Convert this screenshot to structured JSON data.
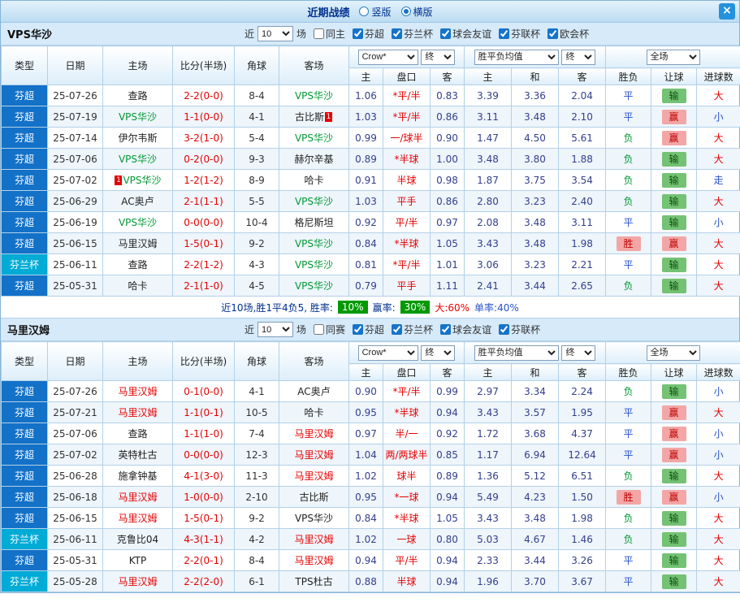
{
  "topbar": {
    "title": "近期战绩",
    "radios": [
      {
        "label": "竖版",
        "selected": false
      },
      {
        "label": "横版",
        "selected": true
      }
    ],
    "close_label": "×"
  },
  "labels": {
    "recent": "近",
    "matches": "场"
  },
  "header": {
    "col_type": "类型",
    "col_date": "日期",
    "col_home": "主场",
    "col_score": "比分(半场)",
    "col_corner": "角球",
    "col_away": "客场",
    "odds_source": "Crow*",
    "odds_final": "终",
    "avg_label": "胜平负均值",
    "avg_final": "终",
    "fulltime": "全场",
    "sub": {
      "home": "主",
      "handicap": "盘口",
      "away": "客",
      "h": "主",
      "d": "和",
      "a": "客",
      "result": "胜负",
      "ah": "让球",
      "goals": "进球数"
    }
  },
  "sections": [
    {
      "team": "VPS华沙",
      "count": "10",
      "same_label": "同主",
      "same_checked": false,
      "leagues": [
        {
          "label": "芬超",
          "checked": true
        },
        {
          "label": "芬兰杯",
          "checked": true
        },
        {
          "label": "球会友谊",
          "checked": true
        },
        {
          "label": "芬联杯",
          "checked": true
        },
        {
          "label": "欧会杯",
          "checked": true
        }
      ],
      "rows": [
        {
          "league": "芬超",
          "date": "25-07-26",
          "home": "查路",
          "score": "2-2(0-0)",
          "corner": "8-4",
          "away": "VPS华沙",
          "away_c": "g",
          "o1": "1.06",
          "hcap": "*平/半",
          "o2": "0.83",
          "w1": "3.39",
          "d": "3.36",
          "w2": "2.04",
          "res": "平",
          "ah": "输",
          "ou": "大"
        },
        {
          "league": "芬超",
          "date": "25-07-19",
          "home": "VPS华沙",
          "home_c": "g",
          "score": "1-1(0-0)",
          "corner": "4-1",
          "away": "古比斯",
          "away_card": "1",
          "away_card_side": "r",
          "o1": "1.03",
          "hcap": "*平/半",
          "o2": "0.86",
          "w1": "3.11",
          "d": "3.48",
          "w2": "2.10",
          "res": "平",
          "ah": "赢",
          "ou": "小"
        },
        {
          "league": "芬超",
          "date": "25-07-14",
          "home": "伊尔韦斯",
          "score": "3-2(1-0)",
          "corner": "5-4",
          "away": "VPS华沙",
          "away_c": "g",
          "o1": "0.99",
          "hcap": "一/球半",
          "o2": "0.90",
          "w1": "1.47",
          "d": "4.50",
          "w2": "5.61",
          "res": "负",
          "ah": "赢",
          "ou": "大"
        },
        {
          "league": "芬超",
          "date": "25-07-06",
          "home": "VPS华沙",
          "home_c": "g",
          "score": "0-2(0-0)",
          "corner": "9-3",
          "away": "赫尔辛基",
          "o1": "0.89",
          "hcap": "*半球",
          "o2": "1.00",
          "w1": "3.48",
          "d": "3.80",
          "w2": "1.88",
          "res": "负",
          "ah": "输",
          "ou": "大"
        },
        {
          "league": "芬超",
          "date": "25-07-02",
          "home": "VPS华沙",
          "home_c": "g",
          "home_card": "1",
          "home_card_side": "l",
          "score": "1-2(1-2)",
          "corner": "8-9",
          "away": "哈卡",
          "o1": "0.91",
          "hcap": "半球",
          "o2": "0.98",
          "w1": "1.87",
          "d": "3.75",
          "w2": "3.54",
          "res": "负",
          "ah": "输",
          "ou": "走"
        },
        {
          "league": "芬超",
          "date": "25-06-29",
          "home": "AC奥卢",
          "score": "2-1(1-1)",
          "corner": "5-5",
          "away": "VPS华沙",
          "away_c": "g",
          "o1": "1.03",
          "hcap": "平手",
          "o2": "0.86",
          "w1": "2.80",
          "d": "3.23",
          "w2": "2.40",
          "res": "负",
          "ah": "输",
          "ou": "大"
        },
        {
          "league": "芬超",
          "date": "25-06-19",
          "home": "VPS华沙",
          "home_c": "g",
          "score": "0-0(0-0)",
          "corner": "10-4",
          "away": "格尼斯坦",
          "o1": "0.92",
          "hcap": "平/半",
          "o2": "0.97",
          "w1": "2.08",
          "d": "3.48",
          "w2": "3.11",
          "res": "平",
          "ah": "输",
          "ou": "小"
        },
        {
          "league": "芬超",
          "date": "25-06-15",
          "home": "马里汉姆",
          "score": "1-5(0-1)",
          "corner": "9-2",
          "away": "VPS华沙",
          "away_c": "g",
          "o1": "0.84",
          "hcap": "*半球",
          "o2": "1.05",
          "w1": "3.43",
          "d": "3.48",
          "w2": "1.98",
          "res": "胜",
          "ah": "赢",
          "ou": "大"
        },
        {
          "league": "芬兰杯",
          "date": "25-06-11",
          "home": "查路",
          "score": "2-2(1-2)",
          "corner": "4-3",
          "away": "VPS华沙",
          "away_c": "g",
          "o1": "0.81",
          "hcap": "*平/半",
          "o2": "1.01",
          "w1": "3.06",
          "d": "3.23",
          "w2": "2.21",
          "res": "平",
          "ah": "输",
          "ou": "大"
        },
        {
          "league": "芬超",
          "date": "25-05-31",
          "home": "哈卡",
          "score": "2-1(1-0)",
          "corner": "4-5",
          "away": "VPS华沙",
          "away_c": "g",
          "o1": "0.79",
          "hcap": "平手",
          "o2": "1.11",
          "w1": "2.41",
          "d": "3.44",
          "w2": "2.65",
          "res": "负",
          "ah": "输",
          "ou": "大"
        }
      ],
      "summary": {
        "text": "近10场,胜1平4负5, 胜率:",
        "win_rate": "10%",
        "ah_label": "赢率:",
        "ah_rate": "30%",
        "over": "大:60%",
        "odd": "单率:40%"
      }
    },
    {
      "team": "马里汉姆",
      "count": "10",
      "same_label": "同赛",
      "same_checked": false,
      "leagues": [
        {
          "label": "芬超",
          "checked": true
        },
        {
          "label": "芬兰杯",
          "checked": true
        },
        {
          "label": "球会友谊",
          "checked": true
        },
        {
          "label": "芬联杯",
          "checked": true
        }
      ],
      "rows": [
        {
          "league": "芬超",
          "date": "25-07-26",
          "home": "马里汉姆",
          "home_c": "r",
          "score": "0-1(0-0)",
          "corner": "4-1",
          "away": "AC奥卢",
          "o1": "0.90",
          "hcap": "*平/半",
          "o2": "0.99",
          "w1": "2.97",
          "d": "3.34",
          "w2": "2.24",
          "res": "负",
          "ah": "输",
          "ou": "小"
        },
        {
          "league": "芬超",
          "date": "25-07-21",
          "home": "马里汉姆",
          "home_c": "r",
          "score": "1-1(0-1)",
          "corner": "10-5",
          "away": "哈卡",
          "o1": "0.95",
          "hcap": "*半球",
          "o2": "0.94",
          "w1": "3.43",
          "d": "3.57",
          "w2": "1.95",
          "res": "平",
          "ah": "赢",
          "ou": "大"
        },
        {
          "league": "芬超",
          "date": "25-07-06",
          "home": "查路",
          "score": "1-1(1-0)",
          "corner": "7-4",
          "away": "马里汉姆",
          "away_c": "r",
          "o1": "0.97",
          "hcap": "半/一",
          "o2": "0.92",
          "w1": "1.72",
          "d": "3.68",
          "w2": "4.37",
          "res": "平",
          "ah": "赢",
          "ou": "小"
        },
        {
          "league": "芬超",
          "date": "25-07-02",
          "home": "英特杜古",
          "score": "0-0(0-0)",
          "corner": "12-3",
          "away": "马里汉姆",
          "away_c": "r",
          "o1": "1.04",
          "hcap": "两/两球半",
          "o2": "0.85",
          "w1": "1.17",
          "d": "6.94",
          "w2": "12.64",
          "res": "平",
          "ah": "赢",
          "ou": "小"
        },
        {
          "league": "芬超",
          "date": "25-06-28",
          "home": "施拿钟基",
          "score": "4-1(3-0)",
          "corner": "11-3",
          "away": "马里汉姆",
          "away_c": "r",
          "o1": "1.02",
          "hcap": "球半",
          "o2": "0.89",
          "w1": "1.36",
          "d": "5.12",
          "w2": "6.51",
          "res": "负",
          "ah": "输",
          "ou": "大"
        },
        {
          "league": "芬超",
          "date": "25-06-18",
          "home": "马里汉姆",
          "home_c": "r",
          "score": "1-0(0-0)",
          "corner": "2-10",
          "away": "古比斯",
          "o1": "0.95",
          "hcap": "*一球",
          "o2": "0.94",
          "w1": "5.49",
          "d": "4.23",
          "w2": "1.50",
          "res": "胜",
          "ah": "赢",
          "ou": "小"
        },
        {
          "league": "芬超",
          "date": "25-06-15",
          "home": "马里汉姆",
          "home_c": "r",
          "score": "1-5(0-1)",
          "corner": "9-2",
          "away": "VPS华沙",
          "o1": "0.84",
          "hcap": "*半球",
          "o2": "1.05",
          "w1": "3.43",
          "d": "3.48",
          "w2": "1.98",
          "res": "负",
          "ah": "输",
          "ou": "大"
        },
        {
          "league": "芬兰杯",
          "date": "25-06-11",
          "home": "克鲁比04",
          "score": "4-3(1-1)",
          "corner": "4-2",
          "away": "马里汉姆",
          "away_c": "r",
          "o1": "1.02",
          "hcap": "一球",
          "o2": "0.80",
          "w1": "5.03",
          "d": "4.67",
          "w2": "1.46",
          "res": "负",
          "ah": "输",
          "ou": "大"
        },
        {
          "league": "芬超",
          "date": "25-05-31",
          "home": "KTP",
          "score": "2-2(0-1)",
          "corner": "8-4",
          "away": "马里汉姆",
          "away_c": "r",
          "o1": "0.94",
          "hcap": "平/半",
          "o2": "0.94",
          "w1": "2.33",
          "d": "3.44",
          "w2": "3.26",
          "res": "平",
          "ah": "输",
          "ou": "大"
        },
        {
          "league": "芬兰杯",
          "date": "25-05-28",
          "home": "马里汉姆",
          "home_c": "r",
          "score": "2-2(2-0)",
          "corner": "6-1",
          "away": "TPS杜古",
          "o1": "0.88",
          "hcap": "半球",
          "o2": "0.94",
          "w1": "1.96",
          "d": "3.70",
          "w2": "3.67",
          "res": "平",
          "ah": "输",
          "ou": "大"
        }
      ]
    }
  ]
}
